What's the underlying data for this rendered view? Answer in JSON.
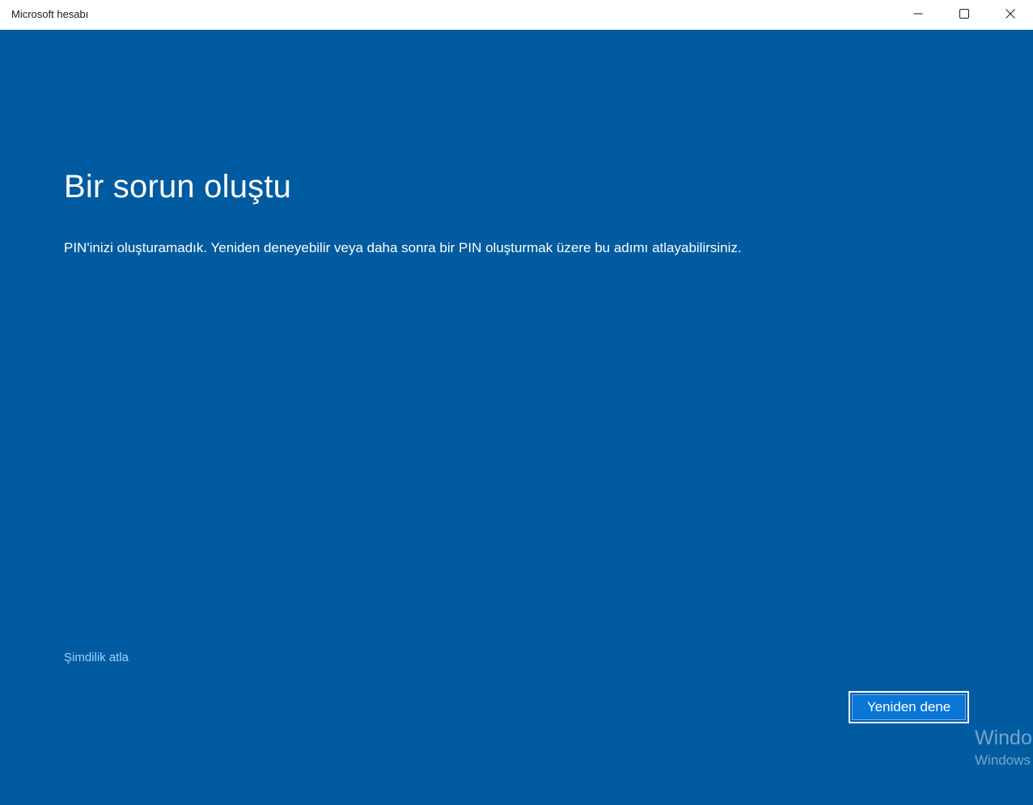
{
  "window": {
    "title": "Microsoft hesabı"
  },
  "controls": {
    "minimize_icon": "minimize-icon",
    "maximize_icon": "maximize-icon",
    "close_icon": "close-icon"
  },
  "main": {
    "heading": "Bir sorun oluştu",
    "message": "PIN'inizi oluşturamadık. Yeniden deneyebilir veya daha sonra bir PIN oluşturmak üzere bu adımı atlayabilirsiniz.",
    "skip_label": "Şimdilik atla",
    "retry_label": "Yeniden dene"
  },
  "watermark": {
    "line1": "Windo",
    "line2": "Windows"
  },
  "colors": {
    "background": "#005ba1",
    "accent_button": "#0a76d6",
    "link": "#9fd2ff",
    "titlebar": "#ffffff"
  }
}
